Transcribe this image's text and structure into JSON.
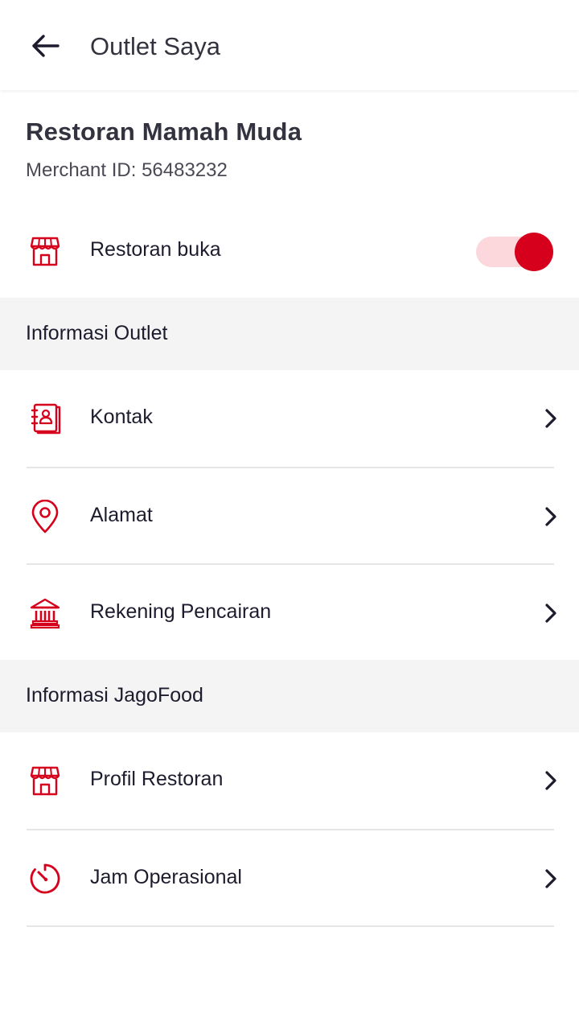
{
  "appbar": {
    "title": "Outlet Saya",
    "back_icon": "arrow-left-icon"
  },
  "merchant": {
    "name": "Restoran Mamah Muda",
    "id_label": "Merchant ID:",
    "id_value": "56483232"
  },
  "open_toggle": {
    "label": "Restoran buka",
    "icon": "storefront-icon",
    "is_on": true
  },
  "sections": [
    {
      "title": "Informasi Outlet",
      "items": [
        {
          "label": "Kontak",
          "icon": "contact-book-icon"
        },
        {
          "label": "Alamat",
          "icon": "location-pin-icon"
        },
        {
          "label": "Rekening Pencairan",
          "icon": "bank-icon"
        }
      ]
    },
    {
      "title": "Informasi JagoFood",
      "items": [
        {
          "label": "Profil Restoran",
          "icon": "storefront-icon"
        },
        {
          "label": "Jam Operasional",
          "icon": "timer-icon"
        }
      ]
    }
  ],
  "colors": {
    "accent": "#d6001c",
    "toggle_track": "#fcd7dc",
    "section_bg": "#f4f4f4",
    "text": "#1c1c2e"
  }
}
